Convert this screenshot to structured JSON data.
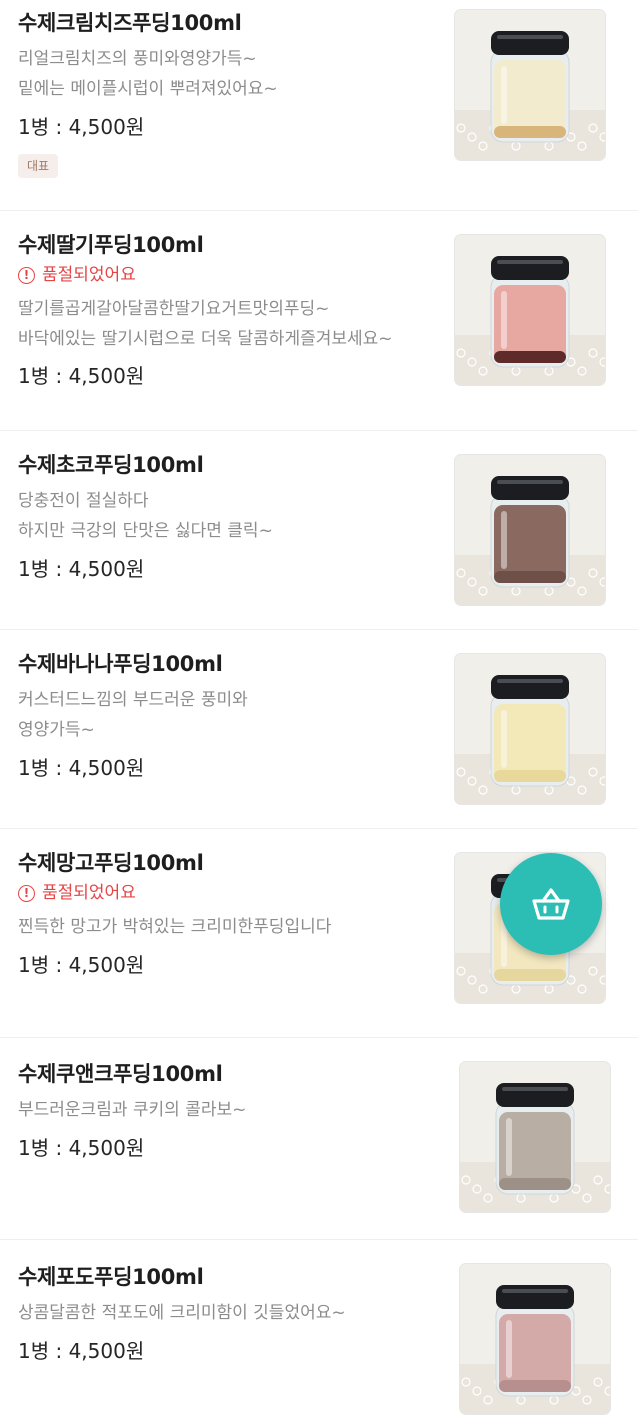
{
  "menu": {
    "items": [
      {
        "name": "수제크림치즈푸딩100ml",
        "soldout": "",
        "desc": [
          "리얼크림치즈의 풍미와영양가득~",
          "밑에는 메이플시럽이 뿌려져있어요~"
        ],
        "price": "1병 : 4,500원",
        "badge": "대표",
        "pudding_color": "#f2ebcd",
        "syrup_color": "#d8b57a"
      },
      {
        "name": "수제딸기푸딩100ml",
        "soldout": "품절되었어요",
        "desc": [
          "딸기를곱게갈아달콤한딸기요거트맛의푸딩~",
          "바닥에있는 딸기시럽으로 더욱 달콤하게즐겨보세요~"
        ],
        "price": "1병 : 4,500원",
        "badge": "",
        "pudding_color": "#e8a8a2",
        "syrup_color": "#5e2a2a"
      },
      {
        "name": "수제초코푸딩100ml",
        "soldout": "",
        "desc": [
          "당충전이 절실하다",
          "하지만 극강의 단맛은 싫다면 클릭~"
        ],
        "price": "1병 : 4,500원",
        "badge": "",
        "pudding_color": "#8a6a60",
        "syrup_color": "#6e5048"
      },
      {
        "name": "수제바나나푸딩100ml",
        "soldout": "",
        "desc": [
          "커스터드느낌의 부드러운 풍미와",
          "영양가득~"
        ],
        "price": "1병 : 4,500원",
        "badge": "",
        "pudding_color": "#f3e8b8",
        "syrup_color": "#e8d89a"
      },
      {
        "name": "수제망고푸딩100ml",
        "soldout": "품절되었어요",
        "desc": [
          "찐득한 망고가 박혀있는 크리미한푸딩입니다"
        ],
        "price": "1병 : 4,500원",
        "badge": "",
        "pudding_color": "#f2e7bf",
        "syrup_color": "#e6d79e"
      },
      {
        "name": "수제쿠앤크푸딩100ml",
        "soldout": "",
        "desc": [
          "부드러운크림과 쿠키의 콜라보~"
        ],
        "price": "1병 : 4,500원",
        "badge": "",
        "pudding_color": "#b9aea4",
        "syrup_color": "#9c9087"
      },
      {
        "name": "수제포도푸딩100ml",
        "soldout": "",
        "desc": [
          "상콤달콤한 적포도에 크리미함이 깃들었어요~"
        ],
        "price": "1병 : 4,500원",
        "badge": "",
        "pudding_color": "#d3aaa8",
        "syrup_color": "#b78f8f"
      }
    ]
  },
  "soldout_icon": "exclamation-circle-icon",
  "fab": {
    "icon": "shopping-basket-icon",
    "color": "#2cbdb4"
  },
  "colors": {
    "soldout": "#e64545",
    "badge_bg": "#f6eeea",
    "badge_text": "#a07a66"
  }
}
